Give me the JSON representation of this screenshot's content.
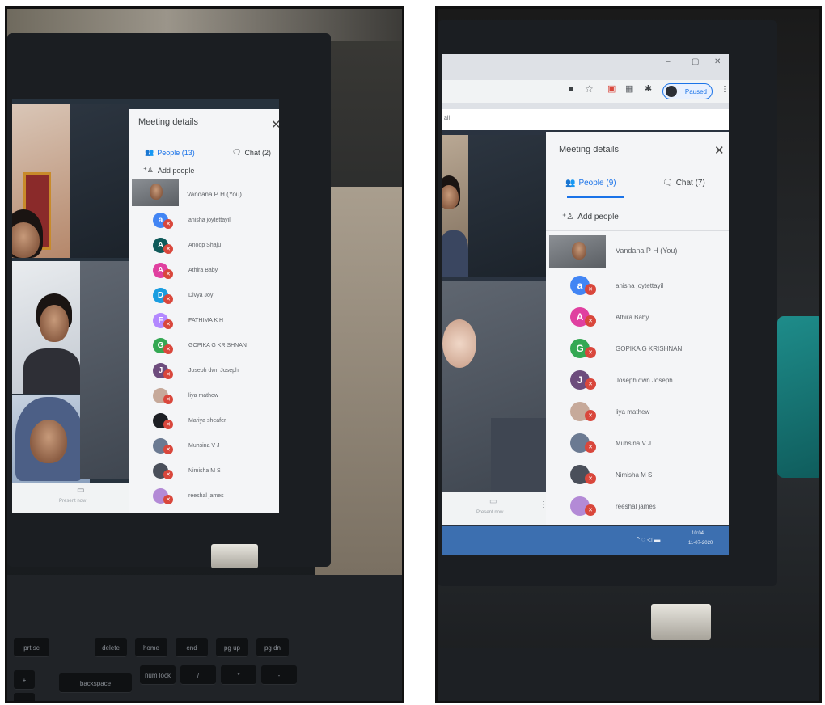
{
  "left_photo": {
    "panel": {
      "title": "Meeting details",
      "close_icon": "close-icon",
      "people_tab": "People (13)",
      "chat_tab": "Chat (2)",
      "add_people": "Add people",
      "self_name": "Vandana P H (You)",
      "participants": [
        {
          "initial": "a",
          "name": "anisha joytettayil",
          "color": "#4285f4"
        },
        {
          "initial": "A",
          "name": "Anoop Shaju",
          "color": "#0f5a5a"
        },
        {
          "initial": "A",
          "name": "Athira Baby",
          "color": "#e040a0"
        },
        {
          "initial": "D",
          "name": "Divya Joy",
          "color": "#1a9de0"
        },
        {
          "initial": "F",
          "name": "FATHIMA K H",
          "color": "#b388ff"
        },
        {
          "initial": "G",
          "name": "GOPIKA G KRISHNAN",
          "color": "#34a853"
        },
        {
          "initial": "J",
          "name": "Joseph dwn Joseph",
          "color": "#6d4c7d"
        },
        {
          "initial": "",
          "name": "liya mathew",
          "color": "#c6a99a"
        },
        {
          "initial": "",
          "name": "Mariya sheafer",
          "color": "#1d1f24"
        },
        {
          "initial": "",
          "name": "Muhsina V J",
          "color": "#6b7a92"
        },
        {
          "initial": "",
          "name": "Nimisha M S",
          "color": "#4a4f5a"
        },
        {
          "initial": "",
          "name": "reeshal james",
          "color": "#b38ad6"
        }
      ]
    },
    "toolbar": {
      "present_label": "Present now",
      "more_icon": "more-vert-icon"
    },
    "keyboard_keys": [
      "prt sc",
      "delete",
      "home",
      "end",
      "pg up",
      "pg dn",
      "backspace",
      "num lock",
      "/",
      "*",
      "-",
      "+",
      "="
    ]
  },
  "right_photo": {
    "browser": {
      "paused_label": "Paused",
      "tab_fragment": "ail",
      "icons": [
        "camera-icon",
        "star-icon",
        "extension-icon",
        "puzzle-icon",
        "profile-icon",
        "kebab-menu-icon"
      ],
      "window_controls": [
        "minimize-icon",
        "restore-icon",
        "close-icon"
      ]
    },
    "panel": {
      "title": "Meeting details",
      "people_tab": "People (9)",
      "chat_tab": "Chat (7)",
      "add_people": "Add people",
      "self_name": "Vandana P H (You)",
      "participants": [
        {
          "initial": "a",
          "name": "anisha joytettayil",
          "color": "#4285f4"
        },
        {
          "initial": "A",
          "name": "Athira Baby",
          "color": "#e040a0"
        },
        {
          "initial": "G",
          "name": "GOPIKA G KRISHNAN",
          "color": "#34a853"
        },
        {
          "initial": "J",
          "name": "Joseph dwn Joseph",
          "color": "#6d4c7d"
        },
        {
          "initial": "",
          "name": "liya mathew",
          "color": "#c6a99a"
        },
        {
          "initial": "",
          "name": "Muhsina V J",
          "color": "#6b7a92"
        },
        {
          "initial": "",
          "name": "Nimisha M S",
          "color": "#4a4f5a"
        },
        {
          "initial": "",
          "name": "reeshal james",
          "color": "#b38ad6"
        }
      ]
    },
    "toolbar": {
      "present_label": "Present now"
    },
    "taskbar": {
      "time": "10:04",
      "date": "11-07-2020"
    }
  }
}
